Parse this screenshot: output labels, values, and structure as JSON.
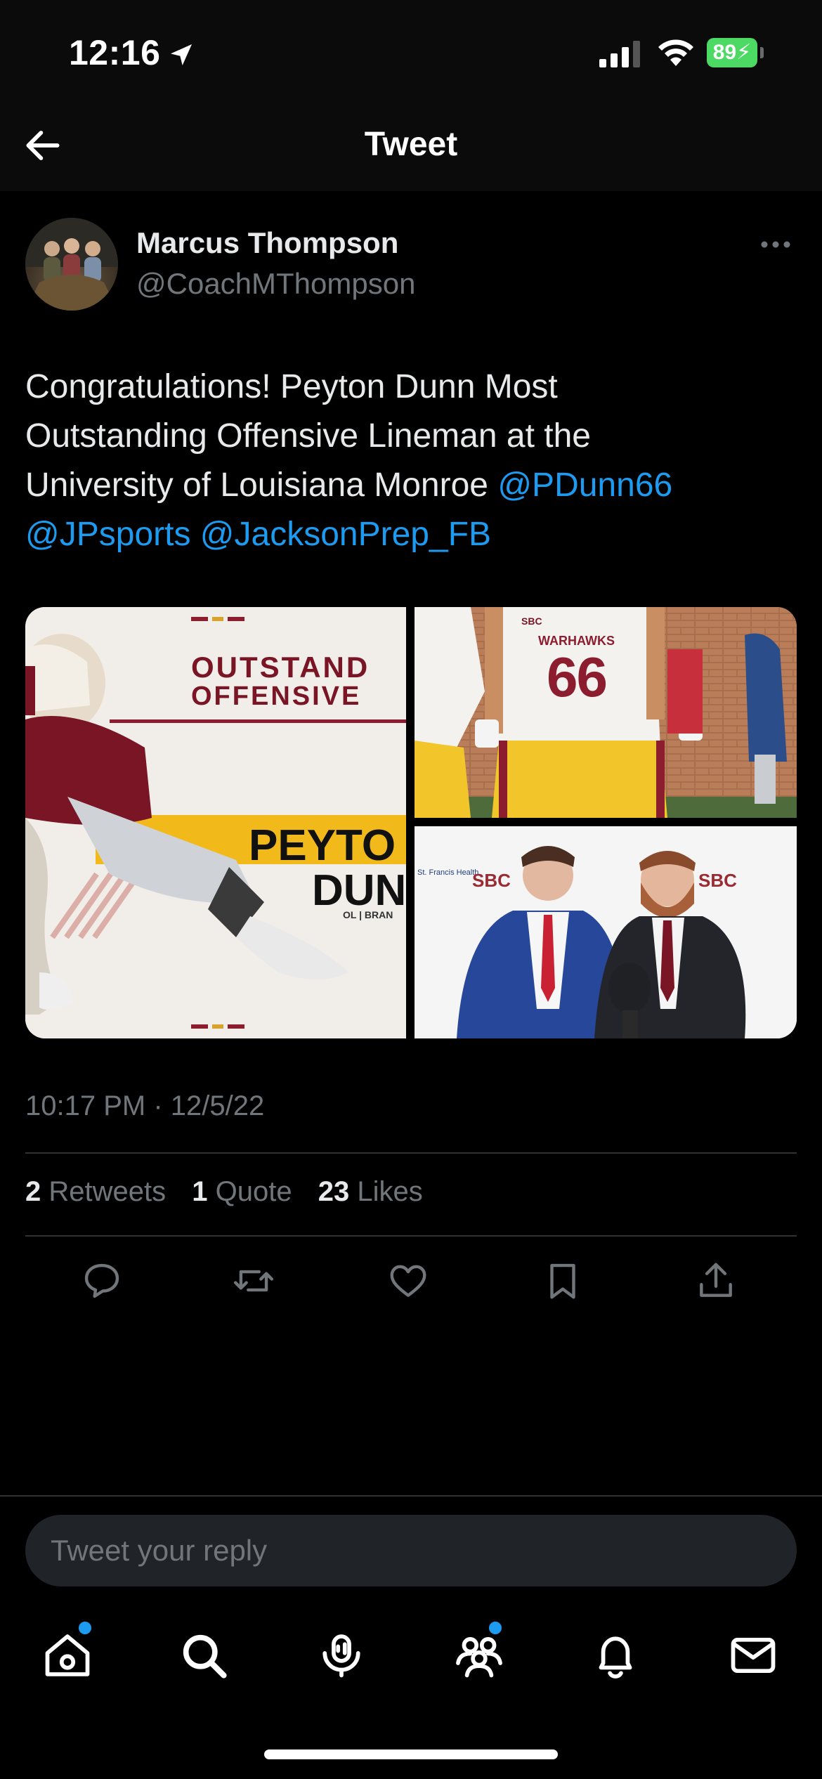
{
  "status_bar": {
    "time": "12:16",
    "battery": "89"
  },
  "header": {
    "title": "Tweet"
  },
  "tweet": {
    "author_name": "Marcus Thompson",
    "author_handle": "@CoachMThompson",
    "text_line1": "Congratulations! Peyton Dunn Most",
    "text_line2": "Outstanding Offensive Lineman at the",
    "text_line3_plain": "University of Louisiana Monroe ",
    "mentions": [
      "@PDunn66",
      "@JPsports",
      "@JacksonPrep_FB"
    ],
    "timestamp": "10:17 PM · 12/5/22",
    "stats": {
      "retweets_count": "2",
      "retweets_label": "Retweets",
      "quotes_count": "1",
      "quotes_label": "Quote",
      "likes_count": "23",
      "likes_label": "Likes"
    },
    "media": {
      "graphic_headline_1": "OUTSTAND",
      "graphic_headline_2": "OFFENSIVE",
      "graphic_name_1": "PEYTO",
      "graphic_name_2": "DUN",
      "graphic_sub": "OL | BRAN",
      "jersey_team": "WARHAWKS",
      "jersey_number": "66",
      "jersey_patch": "SBC",
      "backdrop_logo": "SBC",
      "backdrop_sponsor": "St. Francis Health"
    }
  },
  "reply": {
    "placeholder": "Tweet your reply"
  },
  "colors": {
    "accent": "#1d9bf0",
    "background": "#000000",
    "muted": "#71767b"
  }
}
